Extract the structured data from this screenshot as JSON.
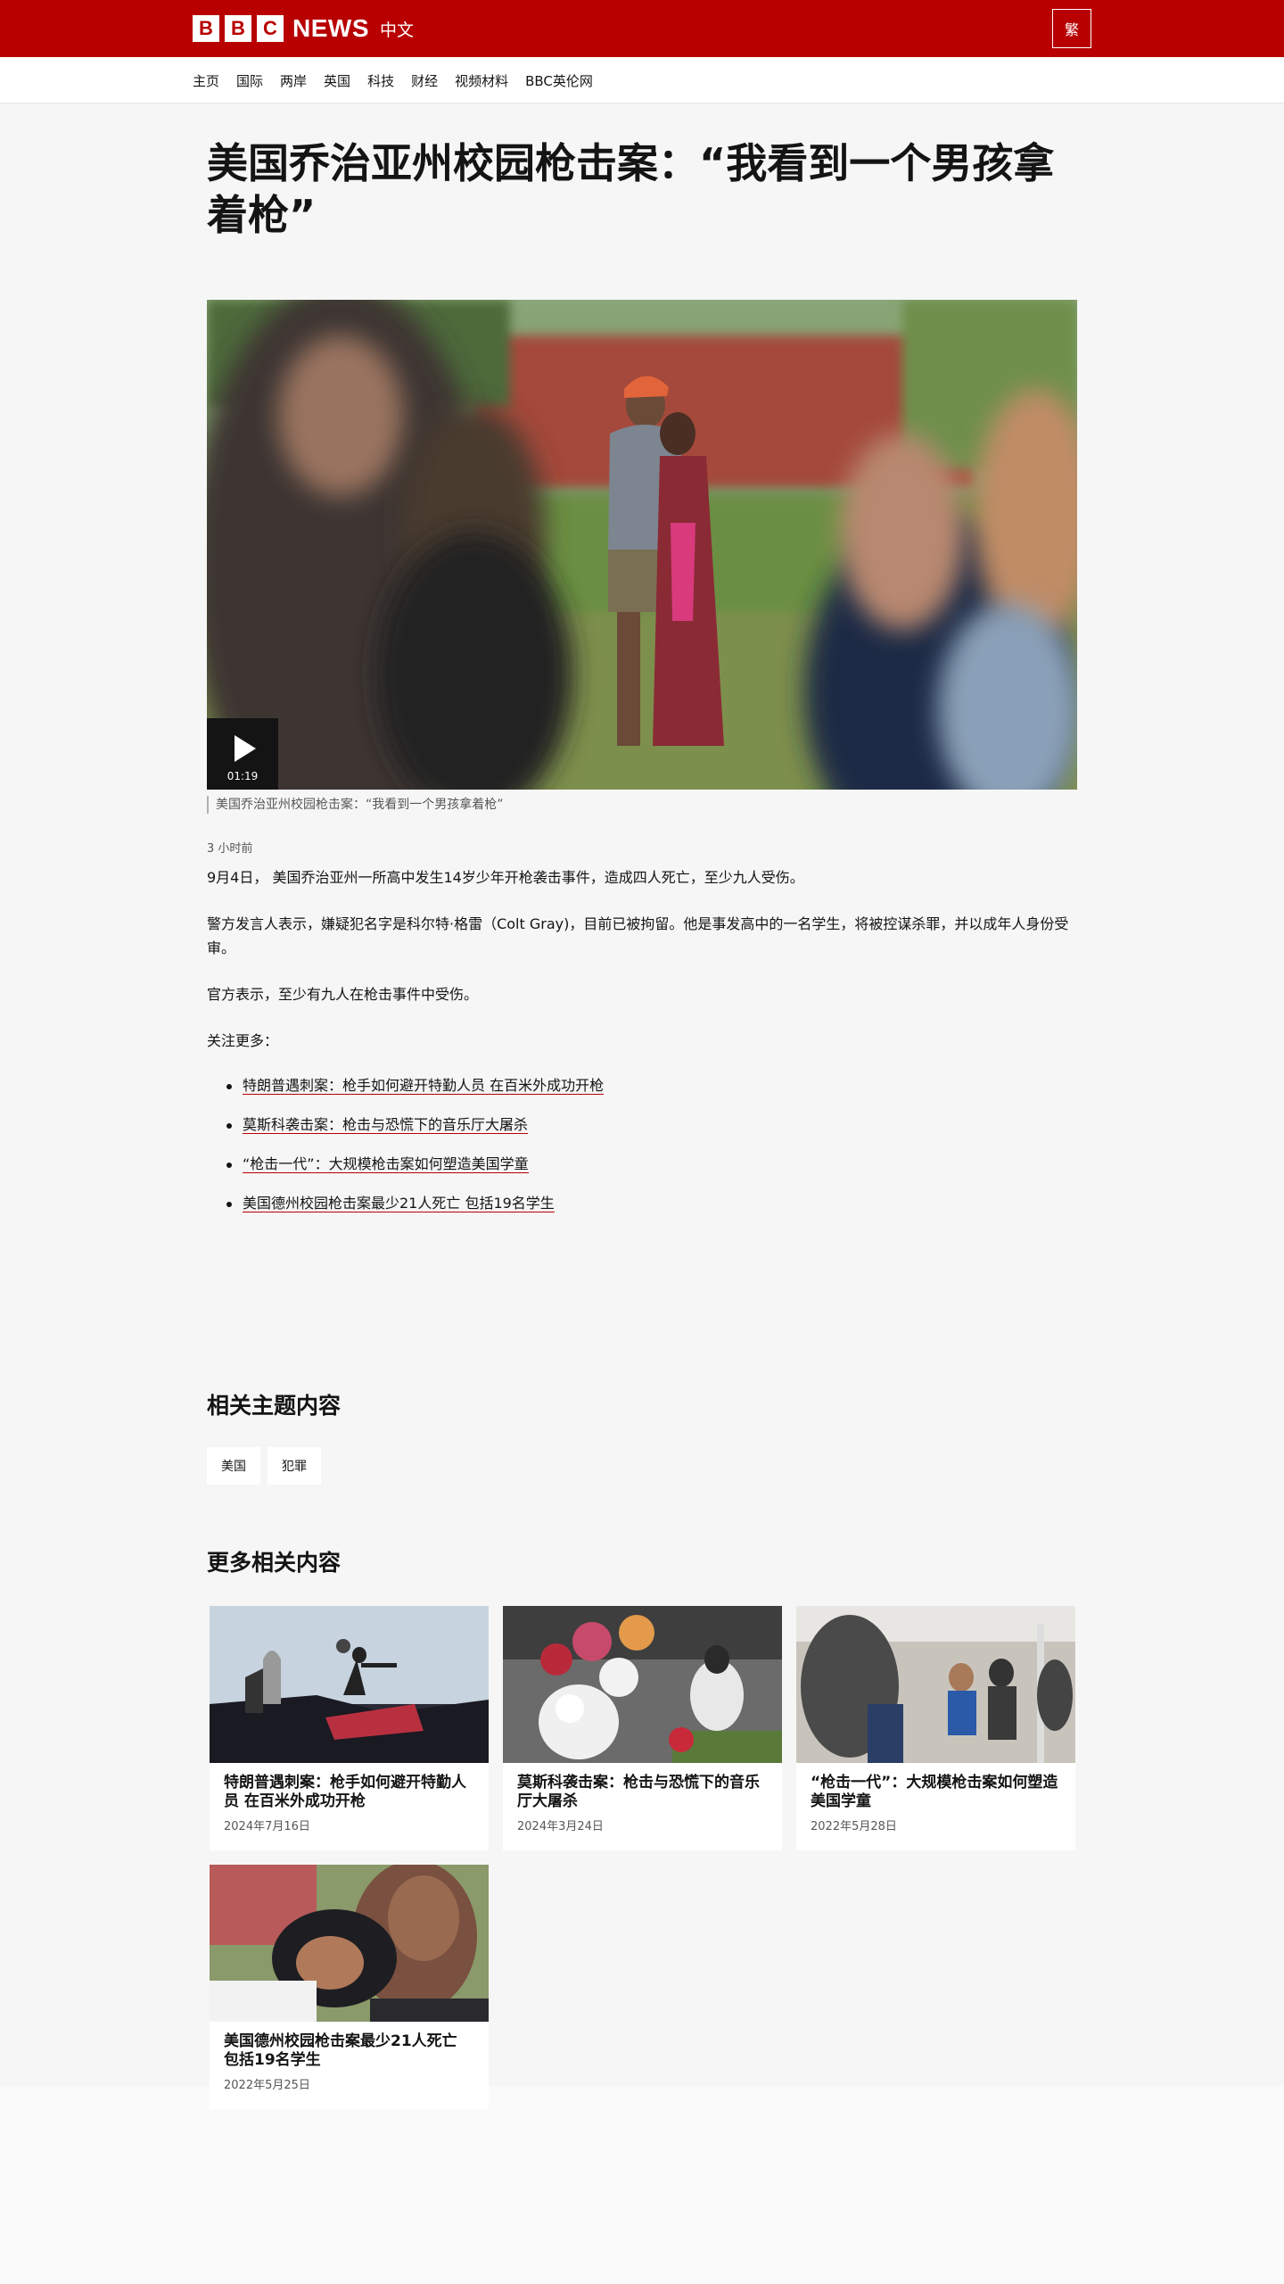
{
  "header": {
    "logo_letters": [
      "B",
      "B",
      "C"
    ],
    "logo_news": "NEWS",
    "logo_lang": "中文",
    "script_toggle": "繁",
    "brand_color": "#b80000"
  },
  "nav": {
    "items": [
      "主页",
      "国际",
      "两岸",
      "英国",
      "科技",
      "财经",
      "视频材料",
      "BBC英伦网"
    ]
  },
  "article": {
    "headline": "美国乔治亚州校园枪击案：“我看到一个男孩拿着枪”",
    "video_duration": "01:19",
    "caption": "美国乔治亚州校园枪击案：“我看到一个男孩拿着枪”",
    "timestamp": "3 小时前",
    "paragraphs": [
      "9月4日， 美国乔治亚州一所高中发生14岁少年开枪袭击事件，造成四人死亡，至少九人受伤。",
      "警方发言人表示，嫌疑犯名字是科尔特·格雷（Colt Gray)，目前已被拘留。他是事发高中的一名学生，将被控谋杀罪，并以成年人身份受审。",
      "官方表示，至少有九人在枪击事件中受伤。",
      "关注更多："
    ],
    "related_links": [
      "特朗普遇刺案：枪手如何避开特勤人员 在百米外成功开枪",
      "莫斯科袭击案：枪击与恐慌下的音乐厅大屠杀",
      "“枪击一代”：大规模枪击案如何塑造美国学童",
      "美国德州校园枪击案最少21人死亡 包括19名学生"
    ]
  },
  "topics": {
    "title": "相关主题内容",
    "tags": [
      "美国",
      "犯罪"
    ]
  },
  "more": {
    "title": "更多相关内容",
    "cards": [
      {
        "title": "特朗普遇刺案：枪手如何避开特勤人员 在百米外成功开枪",
        "date": "2024年7月16日"
      },
      {
        "title": "莫斯科袭击案：枪击与恐慌下的音乐厅大屠杀",
        "date": "2024年3月24日"
      },
      {
        "title": "“枪击一代”：大规模枪击案如何塑造美国学童",
        "date": "2022年5月28日"
      },
      {
        "title": "美国德州校园枪击案最少21人死亡 包括19名学生",
        "date": "2022年5月25日"
      }
    ]
  }
}
